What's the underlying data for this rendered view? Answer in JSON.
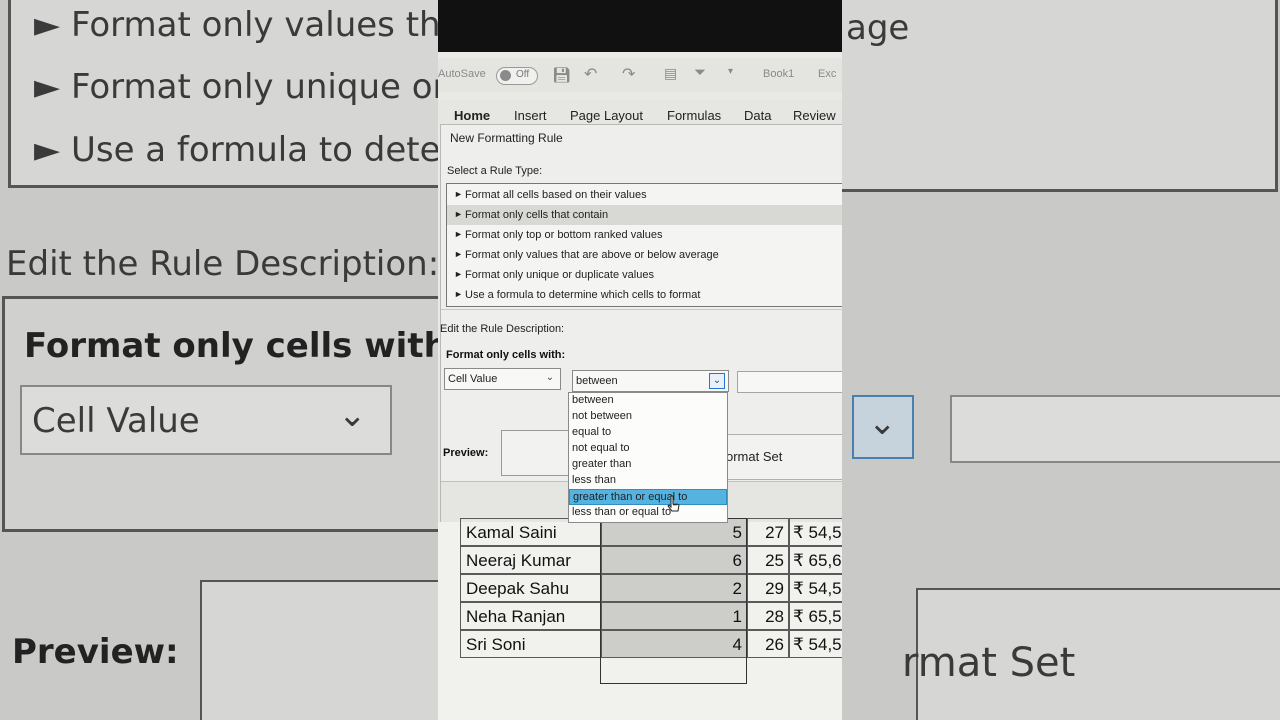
{
  "background": {
    "left_rules": [
      "Format only values tha",
      "Format only unique or",
      "Use a formula to deter"
    ],
    "left_edit_label": "Edit the Rule Description:",
    "left_format_label": "Format only cells with:",
    "left_cell_value": "Cell Value",
    "left_preview": "Preview:",
    "right_rule_tail": "age",
    "right_format_set": "rmat Set"
  },
  "qat": {
    "autosave": "AutoSave",
    "toggle": "Off",
    "book": "Book1",
    "app": "Exc"
  },
  "ribbon": {
    "tabs": [
      "Home",
      "Insert",
      "Page Layout",
      "Formulas",
      "Data",
      "Review"
    ]
  },
  "dialog": {
    "title": "New Formatting Rule",
    "select_rule_label": "Select a Rule Type:",
    "rules": [
      "Format all cells based on their values",
      "Format only cells that contain",
      "Format only top or bottom ranked values",
      "Format only values that are above or below average",
      "Format only unique or duplicate values",
      "Use a formula to determine which cells to format"
    ],
    "edit_label": "Edit the Rule Description:",
    "format_label": "Format only cells with:",
    "cell_value_dropdown": "Cell Value",
    "operator_dropdown": "between",
    "preview_label": "Preview:",
    "format_set_text": "ormat Set",
    "operator_options": [
      "between",
      "not between",
      "equal to",
      "not equal to",
      "greater than",
      "less than",
      "greater than or equal to",
      "less than or equal to"
    ]
  },
  "sheet": {
    "rows": [
      {
        "name": "Kamal Saini",
        "num": "5",
        "age": "27",
        "salary": "₹ 54,5"
      },
      {
        "name": "Neeraj Kumar",
        "num": "6",
        "age": "25",
        "salary": "₹ 65,6"
      },
      {
        "name": "Deepak Sahu",
        "num": "2",
        "age": "29",
        "salary": "₹ 54,5"
      },
      {
        "name": "Neha Ranjan",
        "num": "1",
        "age": "28",
        "salary": "₹ 65,5"
      },
      {
        "name": "Sri Soni",
        "num": "4",
        "age": "26",
        "salary": "₹ 54,5"
      }
    ]
  }
}
